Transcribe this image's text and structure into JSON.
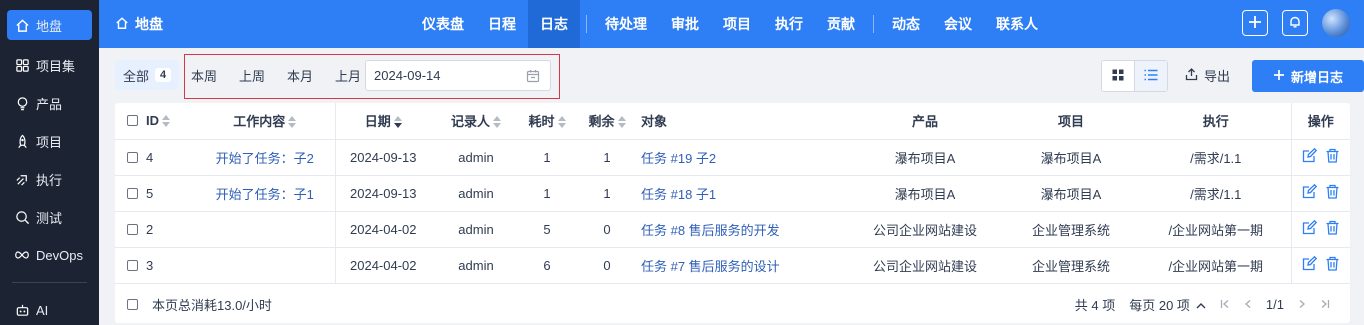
{
  "sidebar": {
    "items": [
      {
        "label": "地盘",
        "icon": "home-icon",
        "active": true
      },
      {
        "label": "项目集",
        "icon": "grid-icon"
      },
      {
        "label": "产品",
        "icon": "bulb-icon"
      },
      {
        "label": "项目",
        "icon": "rocket-icon"
      },
      {
        "label": "执行",
        "icon": "run-icon"
      },
      {
        "label": "测试",
        "icon": "search-bug-icon"
      },
      {
        "label": "DevOps",
        "icon": "infinity-icon"
      },
      {
        "label": "AI",
        "icon": "robot-icon"
      }
    ]
  },
  "header": {
    "breadcrumb": "地盘",
    "nav": [
      "仪表盘",
      "日程",
      "日志",
      "待处理",
      "审批",
      "项目",
      "执行",
      "贡献",
      "动态",
      "会议",
      "联系人"
    ],
    "active_nav": "日志"
  },
  "toolbar": {
    "all_label": "全部",
    "all_count": "4",
    "ranges": [
      "本周",
      "上周",
      "本月",
      "上月"
    ],
    "date_value": "2024-09-14",
    "export_label": "导出",
    "new_label": "新增日志"
  },
  "table": {
    "headers": [
      "ID",
      "工作内容",
      "日期",
      "记录人",
      "耗时",
      "剩余",
      "对象",
      "产品",
      "项目",
      "执行",
      "操作"
    ],
    "rows": [
      {
        "id": "4",
        "content": "开始了任务：子2",
        "date": "2024-09-13",
        "recorder": "admin",
        "consumed": "1",
        "left": "1",
        "object": "任务 #19 子2",
        "product": "瀑布项目A",
        "project": "瀑布项目A",
        "execution": "/需求/1.1"
      },
      {
        "id": "5",
        "content": "开始了任务：子1",
        "date": "2024-09-13",
        "recorder": "admin",
        "consumed": "1",
        "left": "1",
        "object": "任务 #18 子1",
        "product": "瀑布项目A",
        "project": "瀑布项目A",
        "execution": "/需求/1.1"
      },
      {
        "id": "2",
        "content": "",
        "date": "2024-04-02",
        "recorder": "admin",
        "consumed": "5",
        "left": "0",
        "object": "任务 #8 售后服务的开发",
        "product": "公司企业网站建设",
        "project": "企业管理系统",
        "execution": "/企业网站第一期"
      },
      {
        "id": "3",
        "content": "",
        "date": "2024-04-02",
        "recorder": "admin",
        "consumed": "6",
        "left": "0",
        "object": "任务 #7 售后服务的设计",
        "product": "公司企业网站建设",
        "project": "企业管理系统",
        "execution": "/企业网站第一期"
      }
    ]
  },
  "footer": {
    "summary": "本页总消耗13.0/小时",
    "total": "共 4 项",
    "per_page": "每页 20 项",
    "page": "1/1"
  },
  "colors": {
    "primary": "#2e7ff5",
    "sidebar": "#1c2333",
    "link": "#2f5fb8",
    "highlight_border": "#d4394a"
  }
}
